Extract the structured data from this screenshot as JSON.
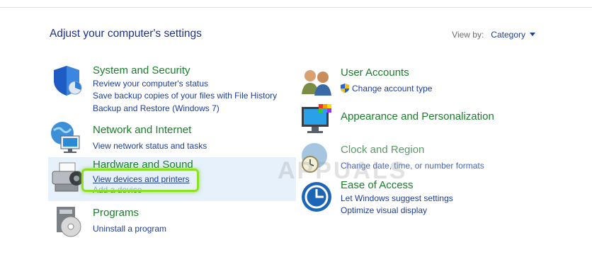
{
  "page": {
    "title": "Adjust your computer's settings",
    "view_by_label": "View by:",
    "view_by_value": "Category"
  },
  "categories": [
    {
      "title": "System and Security",
      "links": [
        "Review your computer's status",
        "Save backup copies of your files with File History",
        "Backup and Restore (Windows 7)"
      ]
    },
    {
      "title": "Network and Internet",
      "links": [
        "View network status and tasks"
      ]
    },
    {
      "title": "Hardware and Sound",
      "links": [
        "View devices and printers",
        "Add a device"
      ]
    },
    {
      "title": "Programs",
      "links": [
        "Uninstall a program"
      ]
    },
    {
      "title": "User Accounts",
      "links": [
        "Change account type"
      ]
    },
    {
      "title": "Appearance and Personalization",
      "links": []
    },
    {
      "title": "Clock and Region",
      "links": [
        "Change date, time, or number formats"
      ]
    },
    {
      "title": "Ease of Access",
      "links": [
        "Let Windows suggest settings",
        "Optimize visual display"
      ]
    }
  ],
  "watermark": "APPUALS",
  "colors": {
    "title_green": "#1a7d2a",
    "link_blue": "#1e3e9c",
    "callout_green": "#8de21f",
    "hover_bg": "#e6f1fb"
  }
}
